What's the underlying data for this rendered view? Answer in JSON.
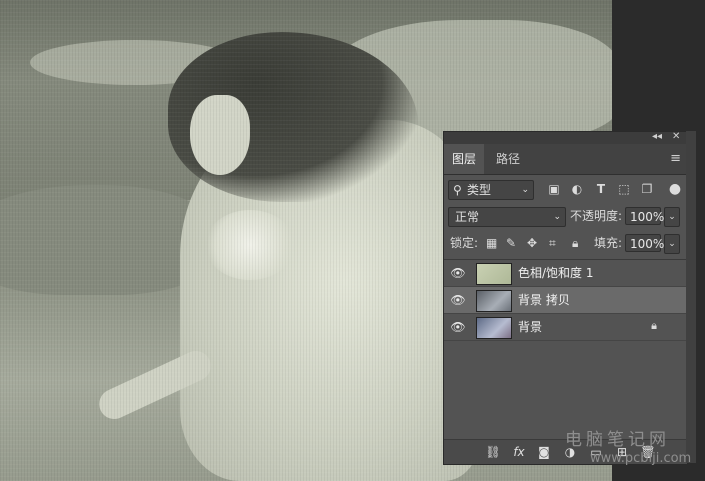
{
  "panel": {
    "tabs": [
      "图层",
      "路径"
    ],
    "filter": {
      "kind_label": "类型"
    },
    "blend_mode": "正常",
    "opacity_label": "不透明度:",
    "opacity_value": "100%",
    "lock_label": "锁定:",
    "fill_label": "填充:",
    "fill_value": "100%",
    "layers": [
      {
        "name": "色相/饱和度 1",
        "visible": true,
        "selected": false
      },
      {
        "name": "背景 拷贝",
        "visible": true,
        "selected": true
      },
      {
        "name": "背景",
        "visible": true,
        "selected": false,
        "locked": true
      }
    ],
    "bottom_icons": [
      "link-icon",
      "fx-icon",
      "mask-icon",
      "adjustment-icon",
      "folder-icon",
      "new-layer-icon",
      "trash-icon"
    ],
    "bottom_fx_label": "fx"
  },
  "watermark": {
    "line1": "电脑笔记网",
    "line2": "www.pcbiji.com"
  },
  "colors": {
    "panel_bg": "#535353",
    "selected_row": "#6a6a6a",
    "workspace": "#2b2b2b"
  }
}
